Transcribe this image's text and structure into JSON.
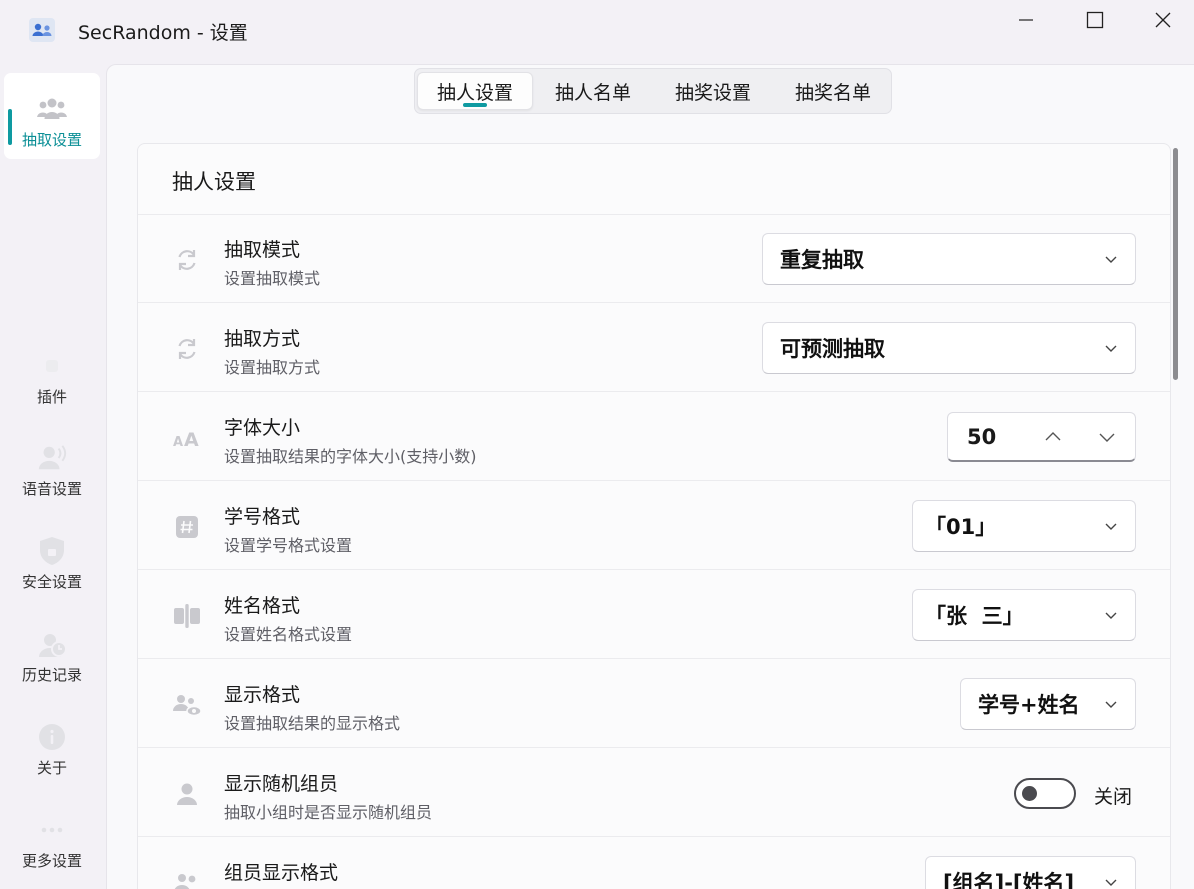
{
  "window": {
    "title": "SecRandom - 设置",
    "controls": {
      "minimize_icon": "minimize-icon",
      "maximize_icon": "maximize-icon",
      "close_icon": "close-icon"
    }
  },
  "sidebar": {
    "items": [
      {
        "label": "抽取设置",
        "icon": "people-group-icon",
        "active": true
      },
      {
        "label": "插件",
        "icon": "plugin-icon",
        "active": false
      },
      {
        "label": "语音设置",
        "icon": "voice-person-icon",
        "active": false
      },
      {
        "label": "安全设置",
        "icon": "shield-icon",
        "active": false
      },
      {
        "label": "历史记录",
        "icon": "history-icon",
        "active": false
      },
      {
        "label": "关于",
        "icon": "info-icon",
        "active": false
      },
      {
        "label": "更多设置",
        "icon": "more-icon",
        "active": false
      }
    ]
  },
  "tabs": [
    {
      "label": "抽人设置",
      "active": true
    },
    {
      "label": "抽人名单",
      "active": false
    },
    {
      "label": "抽奖设置",
      "active": false
    },
    {
      "label": "抽奖名单",
      "active": false
    }
  ],
  "card": {
    "title": "抽人设置",
    "rows": [
      {
        "title": "抽取模式",
        "subtitle": "设置抽取模式",
        "icon": "sync-icon",
        "control": "combo",
        "value": "重复抽取"
      },
      {
        "title": "抽取方式",
        "subtitle": "设置抽取方式",
        "icon": "sync-icon",
        "control": "combo",
        "value": "可预测抽取"
      },
      {
        "title": "字体大小",
        "subtitle": "设置抽取结果的字体大小(支持小数)",
        "icon": "font-size-icon",
        "control": "spin",
        "value": "50"
      },
      {
        "title": "学号格式",
        "subtitle": "设置学号格式设置",
        "icon": "hash-icon",
        "control": "combo",
        "value": "「01」"
      },
      {
        "title": "姓名格式",
        "subtitle": "设置姓名格式设置",
        "icon": "name-tag-icon",
        "control": "combo",
        "value": "「张  三」"
      },
      {
        "title": "显示格式",
        "subtitle": "设置抽取结果的显示格式",
        "icon": "people-view-icon",
        "control": "combo",
        "value": "学号+姓名"
      },
      {
        "title": "显示随机组员",
        "subtitle": "抽取小组时是否显示随机组员",
        "icon": "person-icon",
        "control": "toggle",
        "value": "关闭",
        "on": false
      },
      {
        "title": "组员显示格式",
        "subtitle": "",
        "icon": "people-icon",
        "control": "combo",
        "value": "[组名]-[姓名]"
      }
    ]
  },
  "colors": {
    "accent": "#0e9aa1",
    "icon_gray": "#b5b5bb"
  }
}
